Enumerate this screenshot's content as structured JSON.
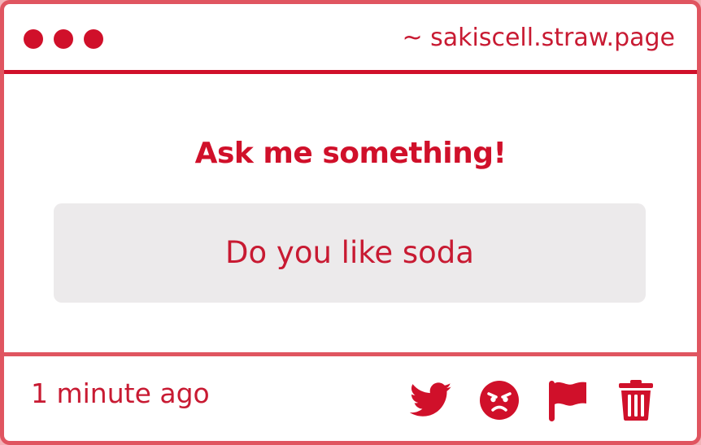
{
  "window": {
    "url": "~ sakiscell.straw.page",
    "dots": [
      "close",
      "minimize",
      "maximize"
    ]
  },
  "main": {
    "heading": "Ask me something!",
    "question": "Do you like soda"
  },
  "footer": {
    "timestamp": "1 minute ago",
    "actions": [
      {
        "name": "twitter-share",
        "icon": "twitter-icon"
      },
      {
        "name": "angry-react",
        "icon": "angry-face-icon"
      },
      {
        "name": "report",
        "icon": "flag-icon"
      },
      {
        "name": "delete",
        "icon": "trash-icon"
      }
    ]
  },
  "colors": {
    "accent": "#d0102a",
    "border": "#e05560",
    "question_bg": "#eceaeb",
    "page_bg": "#f3b3b8"
  }
}
